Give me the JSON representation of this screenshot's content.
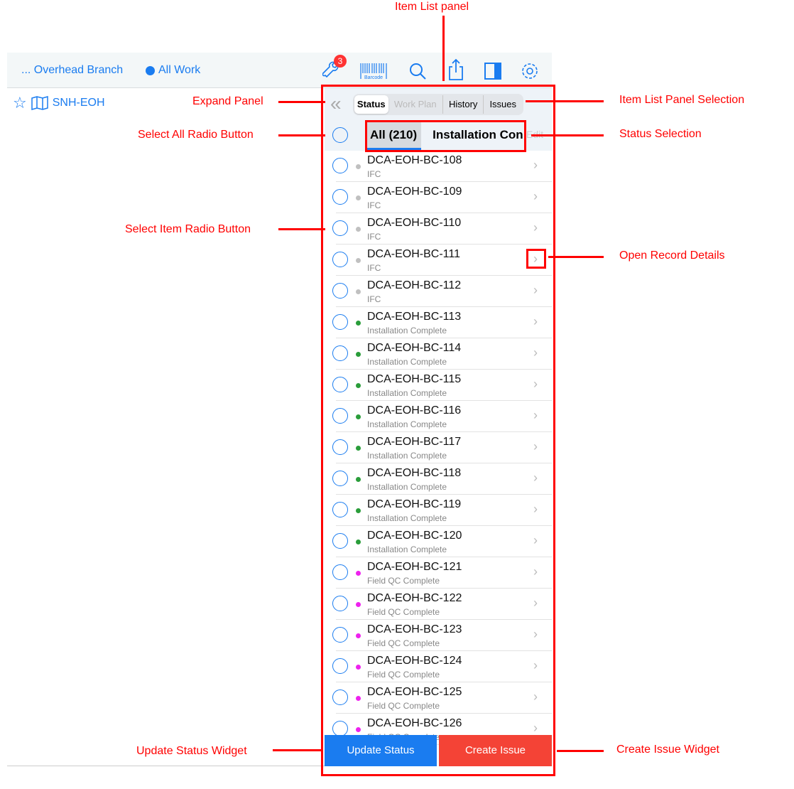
{
  "topbar": {
    "breadcrumb": "... Overhead Branch",
    "filter": "All Work",
    "badge_count": "3",
    "barcode_label": "Barcode",
    "icons": [
      "wrench-icon",
      "barcode-icon",
      "search-icon",
      "share-icon",
      "sidebar-toggle-icon",
      "gear-icon"
    ]
  },
  "sidebar": {
    "project": "SNH-EOH"
  },
  "panel": {
    "tabs": [
      {
        "label": "Status",
        "active": true
      },
      {
        "label": "Work Plan",
        "disabled": true
      },
      {
        "label": "History"
      },
      {
        "label": "Issues"
      }
    ],
    "status_tabs": [
      {
        "label": "All (210)",
        "active": true
      },
      {
        "label": "Installation Con"
      }
    ],
    "edit_label": "Edit",
    "items": [
      {
        "name": "DCA-EOH-BC-108",
        "status": "IFC",
        "color": "#c0c0c0"
      },
      {
        "name": "DCA-EOH-BC-109",
        "status": "IFC",
        "color": "#c0c0c0"
      },
      {
        "name": "DCA-EOH-BC-110",
        "status": "IFC",
        "color": "#c0c0c0"
      },
      {
        "name": "DCA-EOH-BC-111",
        "status": "IFC",
        "color": "#c0c0c0"
      },
      {
        "name": "DCA-EOH-BC-112",
        "status": "IFC",
        "color": "#c0c0c0"
      },
      {
        "name": "DCA-EOH-BC-113",
        "status": "Installation Complete",
        "color": "#2a9d3a"
      },
      {
        "name": "DCA-EOH-BC-114",
        "status": "Installation Complete",
        "color": "#2a9d3a"
      },
      {
        "name": "DCA-EOH-BC-115",
        "status": "Installation Complete",
        "color": "#2a9d3a"
      },
      {
        "name": "DCA-EOH-BC-116",
        "status": "Installation Complete",
        "color": "#2a9d3a"
      },
      {
        "name": "DCA-EOH-BC-117",
        "status": "Installation Complete",
        "color": "#2a9d3a"
      },
      {
        "name": "DCA-EOH-BC-118",
        "status": "Installation Complete",
        "color": "#2a9d3a"
      },
      {
        "name": "DCA-EOH-BC-119",
        "status": "Installation Complete",
        "color": "#2a9d3a"
      },
      {
        "name": "DCA-EOH-BC-120",
        "status": "Installation Complete",
        "color": "#2a9d3a"
      },
      {
        "name": "DCA-EOH-BC-121",
        "status": "Field QC Complete",
        "color": "#ee22ee"
      },
      {
        "name": "DCA-EOH-BC-122",
        "status": "Field QC Complete",
        "color": "#ee22ee"
      },
      {
        "name": "DCA-EOH-BC-123",
        "status": "Field QC Complete",
        "color": "#ee22ee"
      },
      {
        "name": "DCA-EOH-BC-124",
        "status": "Field QC Complete",
        "color": "#ee22ee"
      },
      {
        "name": "DCA-EOH-BC-125",
        "status": "Field QC Complete",
        "color": "#ee22ee"
      },
      {
        "name": "DCA-EOH-BC-126",
        "status": "Field QC Complete",
        "color": "#ee22ee"
      }
    ],
    "update_status": "Update Status",
    "create_issue": "Create Issue"
  },
  "annotations": {
    "item_list_panel": "Item List panel",
    "expand_panel": "Expand Panel",
    "panel_selection": "Item List Panel Selection",
    "select_all": "Select All Radio Button",
    "status_selection": "Status Selection",
    "select_item": "Select Item Radio Button",
    "open_details": "Open Record Details",
    "update_widget": "Update Status Widget",
    "create_widget": "Create Issue Widget"
  },
  "colors": {
    "accent": "#1a7cf0",
    "danger": "#f44336",
    "annotation": "#ff0000"
  }
}
